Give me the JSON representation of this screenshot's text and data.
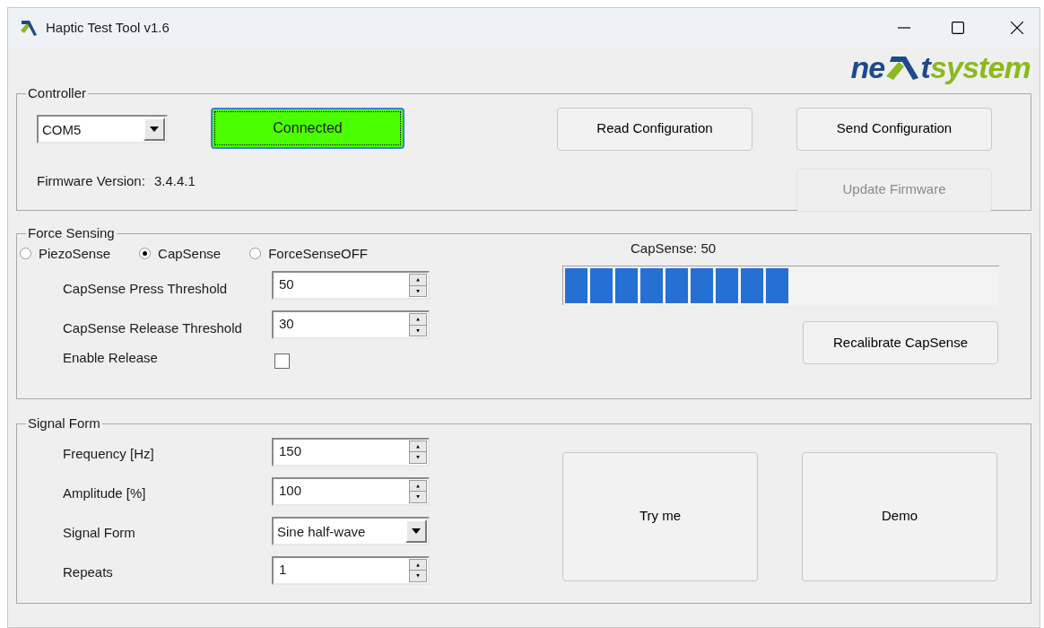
{
  "window": {
    "title": "Haptic Test Tool v1.6"
  },
  "logo": {
    "left": "ne",
    "middle": "t",
    "right": "system"
  },
  "controller": {
    "title": "Controller",
    "port": "COM5",
    "connect_button": {
      "label": "Connected",
      "connected": true
    },
    "firmware_label": "Firmware Version:",
    "firmware_value": "3.4.4.1",
    "buttons": [
      {
        "label": "Read Configuration",
        "disabled": false
      },
      {
        "label": "Send Configuration",
        "disabled": false
      },
      {
        "label": "Update Firmware",
        "disabled": true
      }
    ]
  },
  "force_sensing": {
    "title": "Force Sensing",
    "modes": [
      {
        "label": "PiezoSense",
        "selected": false
      },
      {
        "label": "CapSense",
        "selected": true
      },
      {
        "label": "ForceSenseOFF",
        "selected": false
      }
    ],
    "fields": [
      {
        "label": "CapSense Press Threshold",
        "value": "50"
      },
      {
        "label": "CapSense Release Threshold",
        "value": "30"
      }
    ],
    "enable_release": {
      "label": "Enable Release",
      "checked": false
    },
    "meter": {
      "reading": "CapSense: 50",
      "level": 0.52
    },
    "recalibrate_button": "Recalibrate CapSense"
  },
  "signal_form": {
    "title": "Signal Form",
    "fields": [
      {
        "kind": "spin",
        "label": "Frequency [Hz]",
        "value": "150"
      },
      {
        "kind": "spin",
        "label": "Amplitude [%]",
        "value": "100"
      },
      {
        "kind": "select",
        "label": "Signal Form",
        "value": "Sine half-wave"
      },
      {
        "kind": "spin",
        "label": "Repeats",
        "value": "1"
      }
    ],
    "buttons": [
      "Try me",
      "Demo"
    ]
  }
}
